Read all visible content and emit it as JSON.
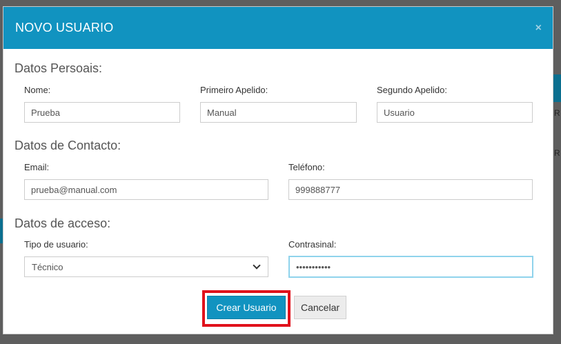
{
  "background": {
    "fragment_1": "R",
    "fragment_2": "R"
  },
  "modal": {
    "title": "NOVO USUARIO",
    "close_symbol": "×",
    "sections": {
      "personal": {
        "title": "Datos Persoais:",
        "name_label": "Nome:",
        "name_value": "Prueba",
        "first_surname_label": "Primeiro Apelido:",
        "first_surname_value": "Manual",
        "second_surname_label": "Segundo Apelido:",
        "second_surname_value": "Usuario"
      },
      "contact": {
        "title": "Datos de Contacto:",
        "email_label": "Email:",
        "email_value": "prueba@manual.com",
        "phone_label": "Teléfono:",
        "phone_value": "999888777"
      },
      "access": {
        "title": "Datos de acceso:",
        "user_type_label": "Tipo de usuario:",
        "user_type_value": "Técnico",
        "password_label": "Contrasinal:",
        "password_value": "•••••••••••"
      }
    },
    "buttons": {
      "create_label": "Crear Usuario",
      "cancel_label": "Cancelar"
    },
    "colors": {
      "header": "#1193c0",
      "highlight": "#e0111b"
    }
  }
}
